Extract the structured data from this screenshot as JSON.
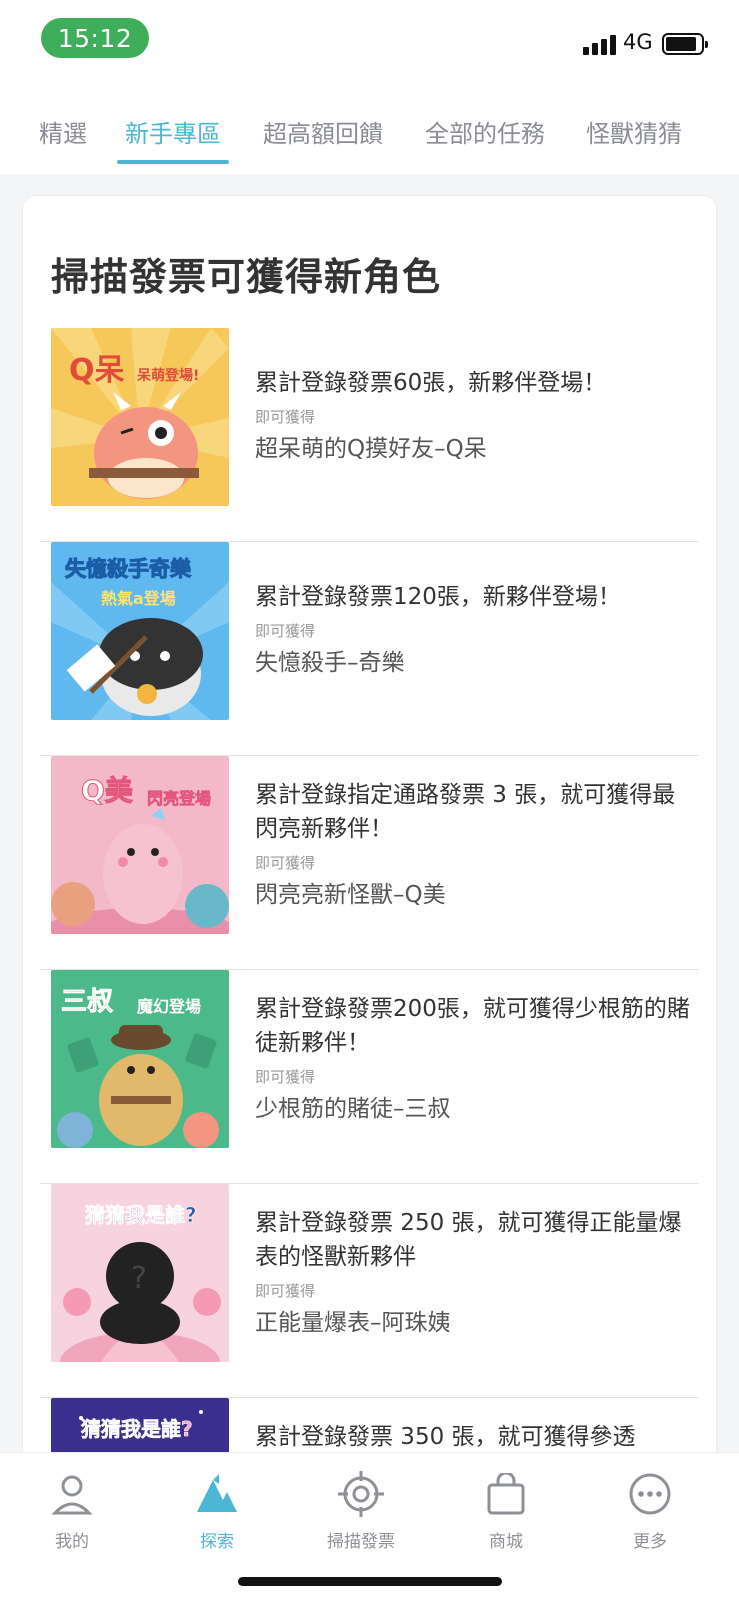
{
  "status": {
    "time": "15:12",
    "network": "4G"
  },
  "tabs": [
    {
      "label": "精選"
    },
    {
      "label": "新手專區"
    },
    {
      "label": "超高額回饋"
    },
    {
      "label": "全部的任務"
    },
    {
      "label": "怪獸猜猜"
    }
  ],
  "active_tab": "新手專區",
  "section": {
    "title": "掃描發票可獲得新角色"
  },
  "items": [
    {
      "title": "累計登錄發票60張，新夥伴登場！",
      "hint": "即可獲得",
      "reward": "超呆萌的Q摸好友–Q呆",
      "thumb": {
        "caption": "Q呆",
        "sub": "呆萌登場!",
        "bg": "#f6c85a"
      }
    },
    {
      "title": "累計登錄發票120張，新夥伴登場！",
      "hint": "即可獲得",
      "reward": "失憶殺手–奇樂",
      "thumb": {
        "caption": "失憶殺手奇樂",
        "sub": "熱氣a登場",
        "bg": "#5fb8ee"
      }
    },
    {
      "title": "累計登錄指定通路發票 3 張，就可獲得最閃亮新夥伴！",
      "hint": "即可獲得",
      "reward": "閃亮亮新怪獸–Q美",
      "thumb": {
        "caption": "Q美",
        "sub": "閃亮登場",
        "bg": "#f3b9c9"
      }
    },
    {
      "title": "累計登錄發票200張，就可獲得少根筋的賭徒新夥伴！",
      "hint": "即可獲得",
      "reward": "少根筋的賭徒–三叔",
      "thumb": {
        "caption": "三叔",
        "sub": "魔幻登場",
        "bg": "#4bb98a"
      }
    },
    {
      "title": "累計登錄發票 250 張，就可獲得正能量爆表的怪獸新夥伴",
      "hint": "即可獲得",
      "reward": "正能量爆表–阿珠姨",
      "thumb": {
        "caption": "猜猜我是誰?",
        "sub": "",
        "bg": "#f7d3df"
      }
    },
    {
      "title": "累計登錄發票 350 張，就可獲得參透",
      "hint": "",
      "reward": "",
      "thumb": {
        "caption": "猜猜我是誰?",
        "sub": "",
        "bg": "#3a2f8e"
      }
    }
  ],
  "bottom_nav": [
    {
      "label": "我的",
      "icon": "user-icon"
    },
    {
      "label": "探索",
      "icon": "mountain-icon"
    },
    {
      "label": "掃描發票",
      "icon": "target-icon"
    },
    {
      "label": "商城",
      "icon": "shopping-bag-icon"
    },
    {
      "label": "更多",
      "icon": "more-dots-icon"
    }
  ],
  "colors": {
    "accent": "#4cb6d6",
    "time_pill": "#3fae5a",
    "text": "#333333",
    "muted": "#8a8d93"
  }
}
